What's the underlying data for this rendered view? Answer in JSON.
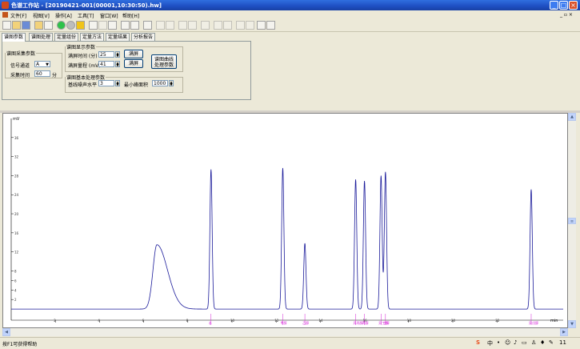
{
  "window": {
    "title": "色谱工作站 - [20190421-001(00001,10:30:50).hw]",
    "minimize": "_",
    "restore": "□",
    "close": "×"
  },
  "menu": [
    "文件[F]",
    "视图[V]",
    "操作[A]",
    "工具[T]",
    "窗口[W]",
    "帮助[H]"
  ],
  "mdi_controls": "_ ▫ ×",
  "tabs": [
    "谱图参数",
    "谱图处理",
    "定量组份",
    "定量方法",
    "定量结果",
    "分析报告"
  ],
  "acquisition": {
    "legend": "谱图采集参数",
    "channel_label": "信号通道",
    "channel_value": "A",
    "time_label": "采集时间",
    "time_value": "60",
    "time_unit": "分"
  },
  "display": {
    "legend": "谱图显示参数",
    "time_label": "满屏时间 (分)",
    "time_value": "25",
    "range_label": "满屏量程 (mV)",
    "range_value": "41",
    "full_button": "满屏",
    "full_button2": "满屏",
    "curve_button_line1": "谱图曲线",
    "curve_button_line2": "处理参数"
  },
  "processing": {
    "legend": "谱图基本处理参数",
    "threshold_label": "基线噪声水平",
    "threshold_value": "3",
    "min_area_label": "最小峰面积",
    "min_area_value": "1000"
  },
  "status": {
    "text": "按F1可获得帮助",
    "clock": "11"
  },
  "chart_data": {
    "type": "line",
    "ylabel": "mV",
    "xlabel": "min",
    "xlim": [
      0,
      25
    ],
    "ylim": [
      -2,
      40
    ],
    "y_ticks": [
      2,
      4,
      6,
      8,
      12,
      16,
      20,
      24,
      28,
      32,
      36
    ],
    "x_ticks": [
      2,
      4,
      6,
      8,
      10,
      12,
      14,
      16,
      18,
      20,
      22
    ],
    "peaks": [
      {
        "t": 6.6,
        "h": 13.5,
        "w": 0.18,
        "tail": 0.5
      },
      {
        "t": 9.05,
        "h": 29.3,
        "w": 0.05
      },
      {
        "t": 12.3,
        "h": 29.6,
        "w": 0.05
      },
      {
        "t": 13.3,
        "h": 13.8,
        "w": 0.05
      },
      {
        "t": 15.6,
        "h": 27.2,
        "w": 0.05
      },
      {
        "t": 16.0,
        "h": 26.9,
        "w": 0.05
      },
      {
        "t": 16.75,
        "h": 28.0,
        "w": 0.05
      },
      {
        "t": 16.95,
        "h": 28.8,
        "w": 0.05
      },
      {
        "t": 23.55,
        "h": 25.1,
        "w": 0.05
      }
    ],
    "peak_labels": [
      "水",
      "甲醇",
      "乙醇",
      "异丙醇",
      "丙醇",
      "异丁醇",
      "丁醇",
      "异戊醇",
      "戊醇"
    ],
    "colors": {
      "trace": "#1a1a9a",
      "marker": "#d41ed6",
      "axis": "#000000"
    }
  }
}
